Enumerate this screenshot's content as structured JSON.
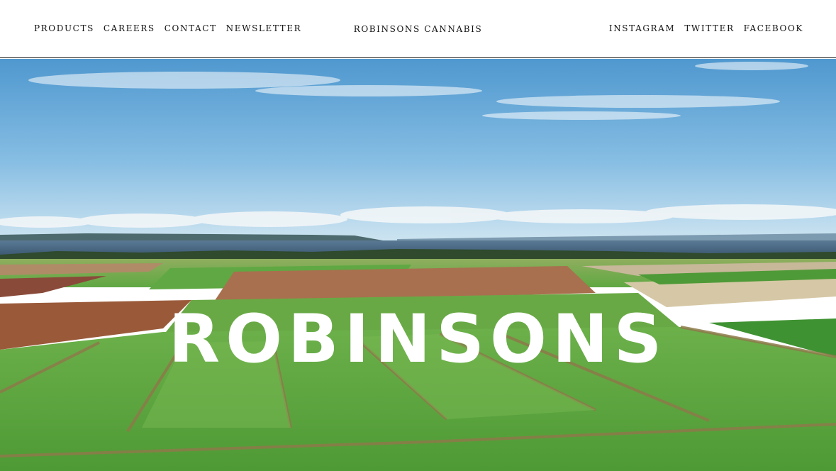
{
  "header": {
    "nav_left": [
      "PRODUCTS",
      "CAREERS",
      "CONTACT",
      "NEWSLETTER"
    ],
    "brand": "ROBINSONS CANNABIS",
    "nav_right": [
      "INSTAGRAM",
      "TWITTER",
      "FACEBOOK"
    ]
  },
  "hero": {
    "title": "ROBINSONS",
    "image": "aerial-farmland-coastline"
  },
  "colors": {
    "header_bg": "#ffffff",
    "nav_text": "#111111",
    "hero_title": "#ffffff",
    "sky_top": "#5a9fd2",
    "sky_bottom": "#c6e1f0",
    "field_green": "#5fa843",
    "field_brown": "#9a5a3a"
  }
}
